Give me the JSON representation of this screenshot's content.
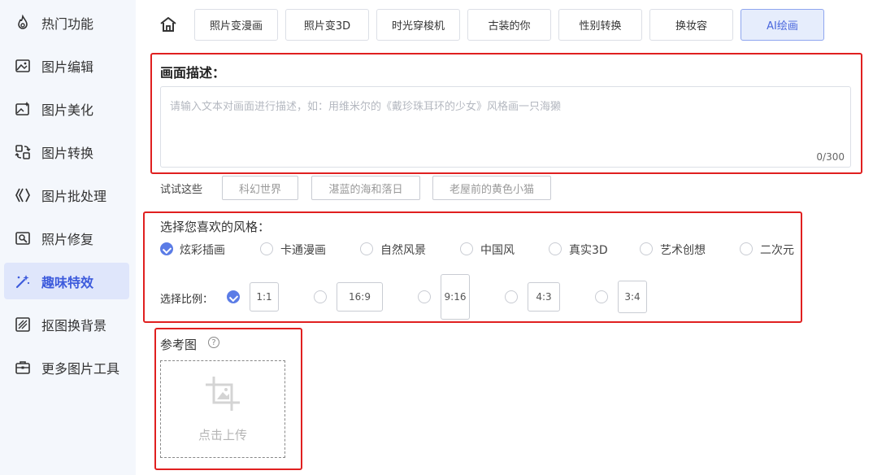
{
  "sidebar": {
    "items": [
      {
        "label": "热门功能",
        "icon": "fire-icon"
      },
      {
        "label": "图片编辑",
        "icon": "image-edit-icon"
      },
      {
        "label": "图片美化",
        "icon": "image-beauty-icon"
      },
      {
        "label": "图片转换",
        "icon": "convert-icon"
      },
      {
        "label": "图片批处理",
        "icon": "batch-icon"
      },
      {
        "label": "照片修复",
        "icon": "photo-repair-icon"
      },
      {
        "label": "趣味特效",
        "icon": "magic-wand-icon",
        "active": true
      },
      {
        "label": "抠图换背景",
        "icon": "cutout-icon"
      },
      {
        "label": "更多图片工具",
        "icon": "toolbox-icon"
      }
    ]
  },
  "tabs": [
    "照片变漫画",
    "照片变3D",
    "时光穿梭机",
    "古装的你",
    "性别转换",
    "换妆容",
    "AI绘画"
  ],
  "active_tab": "AI绘画",
  "description": {
    "title": "画面描述：",
    "placeholder": "请输入文本对画面进行描述，如：用维米尔的《戴珍珠耳环的少女》风格画一只海獭",
    "counter": "0/300"
  },
  "try": {
    "label": "试试这些",
    "suggestions": [
      "科幻世界",
      "湛蓝的海和落日",
      "老屋前的黄色小猫"
    ]
  },
  "style": {
    "title": "选择您喜欢的风格：",
    "options": [
      "炫彩插画",
      "卡通漫画",
      "自然风景",
      "中国风",
      "真实3D",
      "艺术创想",
      "二次元"
    ],
    "selected": "炫彩插画"
  },
  "ratio": {
    "label": "选择比例：",
    "options": [
      "1:1",
      "16:9",
      "9:16",
      "4:3",
      "3:4"
    ],
    "selected": "1:1"
  },
  "reference": {
    "title": "参考图",
    "help": "?",
    "upload_text": "点击上传"
  },
  "colors": {
    "accent": "#5b7ce6",
    "highlight_frame": "#e02020",
    "sidebar_bg": "#f4f7fc"
  }
}
